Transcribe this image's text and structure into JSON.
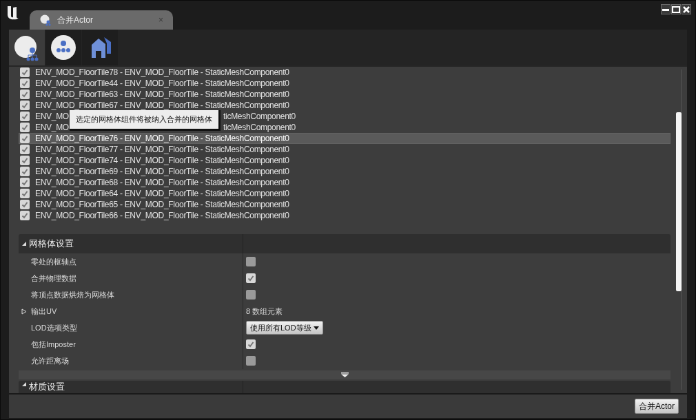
{
  "window": {
    "title": "合并Actor",
    "tab_close": "×"
  },
  "toolbar": [
    {
      "kind": "actors",
      "selected": true
    },
    {
      "kind": "proxy",
      "selected": false
    },
    {
      "kind": "houses",
      "selected": false
    }
  ],
  "components": [
    {
      "kind": "full",
      "text": "ENV_MOD_FloorTile78 - ENV_MOD_FloorTile - StaticMeshComponent0",
      "checked": true,
      "selected": false
    },
    {
      "kind": "full",
      "text": "ENV_MOD_FloorTile44 - ENV_MOD_FloorTile - StaticMeshComponent0",
      "checked": true,
      "selected": false
    },
    {
      "kind": "full",
      "text": "ENV_MOD_FloorTile63 - ENV_MOD_FloorTile - StaticMeshComponent0",
      "checked": true,
      "selected": false
    },
    {
      "kind": "full",
      "text": "ENV_MOD_FloorTile67 - ENV_MOD_FloorTile - StaticMeshComponent0",
      "checked": true,
      "selected": false
    },
    {
      "kind": "covered",
      "text_start": "ENV_MO",
      "text_end": "ticMeshComponent0",
      "checked": true,
      "selected": false
    },
    {
      "kind": "covered",
      "text_start": "ENV_MO",
      "text_end": "ticMeshComponent0",
      "checked": true,
      "selected": false
    },
    {
      "kind": "full",
      "text": "ENV_MOD_FloorTile76 - ENV_MOD_FloorTile - StaticMeshComponent0",
      "checked": true,
      "selected": true
    },
    {
      "kind": "full",
      "text": "ENV_MOD_FloorTile77 - ENV_MOD_FloorTile - StaticMeshComponent0",
      "checked": true,
      "selected": false
    },
    {
      "kind": "full",
      "text": "ENV_MOD_FloorTile74 - ENV_MOD_FloorTile - StaticMeshComponent0",
      "checked": true,
      "selected": false
    },
    {
      "kind": "full",
      "text": "ENV_MOD_FloorTile69 - ENV_MOD_FloorTile - StaticMeshComponent0",
      "checked": true,
      "selected": false
    },
    {
      "kind": "full",
      "text": "ENV_MOD_FloorTile68 - ENV_MOD_FloorTile - StaticMeshComponent0",
      "checked": true,
      "selected": false
    },
    {
      "kind": "full",
      "text": "ENV_MOD_FloorTile64 - ENV_MOD_FloorTile - StaticMeshComponent0",
      "checked": true,
      "selected": false
    },
    {
      "kind": "full",
      "text": "ENV_MOD_FloorTile65 - ENV_MOD_FloorTile - StaticMeshComponent0",
      "checked": true,
      "selected": false
    },
    {
      "kind": "full",
      "text": "ENV_MOD_FloorTile66 - ENV_MOD_FloorTile - StaticMeshComponent0",
      "checked": true,
      "selected": false
    }
  ],
  "tooltip": {
    "text": "选定的网格体组件将被纳入合并的网格体"
  },
  "mesh_settings": {
    "title": "网格体设置",
    "expanded": true,
    "rows": [
      {
        "kind": "checkbox",
        "label": "零处的枢轴点",
        "checked": false
      },
      {
        "kind": "checkbox",
        "label": "合并物理数据",
        "checked": true
      },
      {
        "kind": "checkbox",
        "label": "将顶点数据烘焙为网格体",
        "checked": false
      },
      {
        "kind": "array",
        "label": "输出UV",
        "expanded": false,
        "value": "8 数组元素"
      },
      {
        "kind": "dropdown",
        "label": "LOD选项类型",
        "value": "使用所有LOD等级"
      },
      {
        "kind": "checkbox",
        "label": "包括Imposter",
        "checked": true
      },
      {
        "kind": "checkbox",
        "label": "允许距离场",
        "checked": false
      }
    ]
  },
  "material_settings": {
    "title": "材质设置",
    "expanded": true
  },
  "footer": {
    "button": "合并Actor"
  }
}
